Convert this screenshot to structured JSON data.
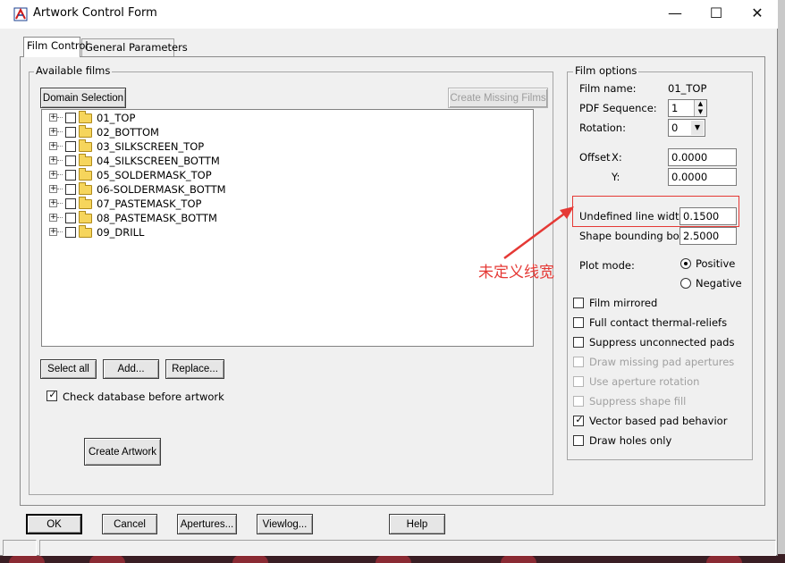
{
  "window": {
    "title": "Artwork Control Form"
  },
  "titlebar_controls": {
    "minimize": "—",
    "maximize": "☐",
    "close": "✕"
  },
  "tabs": [
    {
      "label": "Film Control",
      "active": true
    },
    {
      "label": "General Parameters",
      "active": false
    }
  ],
  "available_films": {
    "group_label": "Available films",
    "domain_selection": "Domain Selection",
    "create_missing": "Create Missing Films",
    "films": [
      "01_TOP",
      "02_BOTTOM",
      "03_SILKSCREEN_TOP",
      "04_SILKSCREEN_BOTTM",
      "05_SOLDERMASK_TOP",
      "06-SOLDERMASK_BOTTM",
      "07_PASTEMASK_TOP",
      "08_PASTEMASK_BOTTM",
      "09_DRILL"
    ],
    "select_all": "Select all",
    "add": "Add...",
    "replace": "Replace...",
    "check_db_label": "Check database before artwork",
    "check_db_checked": true,
    "create_artwork": "Create Artwork"
  },
  "film_options": {
    "group_label": "Film options",
    "film_name_label": "Film name:",
    "film_name_value": "01_TOP",
    "pdf_sequence_label": "PDF Sequence:",
    "pdf_sequence_value": "1",
    "rotation_label": "Rotation:",
    "rotation_value": "0",
    "offset_label": "Offset",
    "offset_x_label": "X:",
    "offset_x_value": "0.0000",
    "offset_y_label": "Y:",
    "offset_y_value": "0.0000",
    "undefined_line_width_label": "Undefined line width:",
    "undefined_line_width_value": "0.1500",
    "shape_bounding_box_label": "Shape bounding box:",
    "shape_bounding_box_value": "2.5000",
    "plot_mode_label": "Plot mode:",
    "plot_positive": "Positive",
    "plot_negative": "Negative",
    "plot_mode_selected": "Positive",
    "checkboxes": [
      {
        "label": "Film mirrored",
        "checked": false,
        "enabled": true
      },
      {
        "label": "Full contact thermal-reliefs",
        "checked": false,
        "enabled": true
      },
      {
        "label": "Suppress unconnected pads",
        "checked": false,
        "enabled": true
      },
      {
        "label": "Draw missing pad apertures",
        "checked": false,
        "enabled": false
      },
      {
        "label": "Use aperture rotation",
        "checked": false,
        "enabled": false
      },
      {
        "label": "Suppress shape fill",
        "checked": false,
        "enabled": false
      },
      {
        "label": "Vector based pad behavior",
        "checked": true,
        "enabled": true
      },
      {
        "label": "Draw holes only",
        "checked": false,
        "enabled": true
      }
    ]
  },
  "bottom_buttons": {
    "ok": "OK",
    "cancel": "Cancel",
    "apertures": "Apertures...",
    "viewlog": "Viewlog...",
    "help": "Help"
  },
  "annotation": {
    "text": "未定义线宽",
    "color": "#e53935"
  },
  "colors": {
    "annotation": "#e53935",
    "folder": "#f6d55c"
  }
}
